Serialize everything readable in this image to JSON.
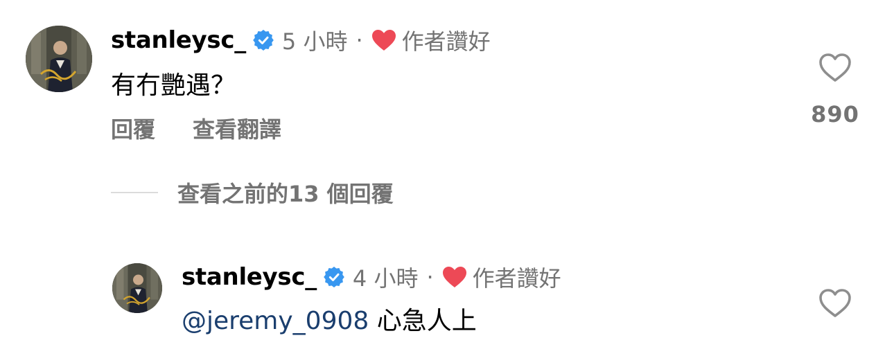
{
  "comment": {
    "username": "stanleysc_",
    "time": "5 小時",
    "separator": "·",
    "liked_by_author": "作者讚好",
    "text": "有冇艷遇？",
    "reply_label": "回覆",
    "translate_label": "查看翻譯",
    "like_count": "890",
    "verified_icon": "verified-badge-icon",
    "heart_color": "#ed4956",
    "verified_color": "#3897f0"
  },
  "view_replies": {
    "label": "查看之前的13 個回覆"
  },
  "reply": {
    "username": "stanleysc_",
    "time": "4 小時",
    "separator": "·",
    "liked_by_author": "作者讚好",
    "mention": "@jeremy_0908",
    "text": " 心急人上"
  }
}
